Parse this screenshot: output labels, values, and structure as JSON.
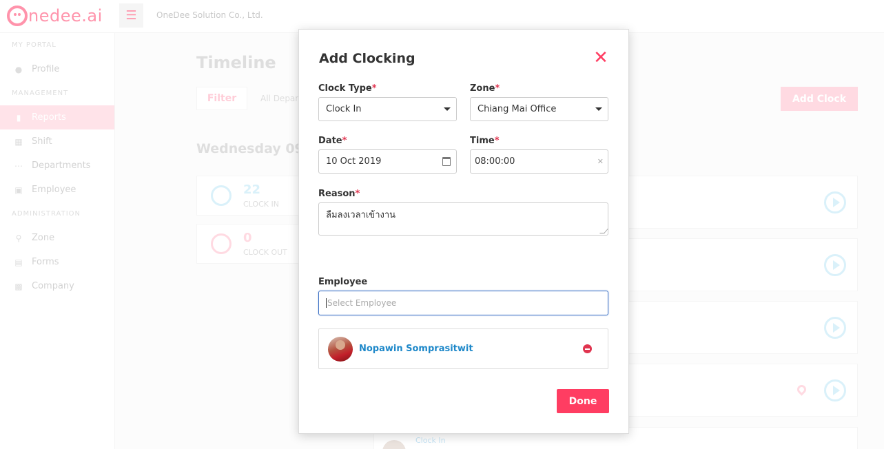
{
  "header": {
    "logo_text": "nedee.ai",
    "company": "OneDee Solution Co., Ltd."
  },
  "sidebar": {
    "sections": [
      {
        "title": "MY PORTAL",
        "items": [
          {
            "label": "Profile",
            "icon": "user-circle-icon"
          }
        ]
      },
      {
        "title": "MANAGEMENT",
        "items": [
          {
            "label": "Reports",
            "icon": "document-icon",
            "active": true
          },
          {
            "label": "Shift",
            "icon": "shift-icon"
          },
          {
            "label": "Departments",
            "icon": "users-icon"
          },
          {
            "label": "Employee",
            "icon": "id-card-icon"
          }
        ]
      },
      {
        "title": "ADMINISTRATION",
        "items": [
          {
            "label": "Zone",
            "icon": "pin-icon"
          },
          {
            "label": "Forms",
            "icon": "clipboard-icon"
          },
          {
            "label": "Company",
            "icon": "building-icon"
          }
        ]
      }
    ]
  },
  "main": {
    "title": "Timeline",
    "filter_label": "Filter",
    "department_filter": "All Depar",
    "add_clock_label": "Add Clock",
    "date_heading": "Wednesday 09",
    "stats": [
      {
        "value": "22",
        "label": "CLOCK IN",
        "color": "#c6eaf7"
      },
      {
        "value": "0",
        "label": "CLOCK OUT",
        "color": "#ffc7d3"
      }
    ],
    "bottom_entry_label": "Clock In"
  },
  "modal": {
    "title": "Add Clocking",
    "clock_type": {
      "label": "Clock Type",
      "value": "Clock In"
    },
    "zone": {
      "label": "Zone",
      "value": "Chiang Mai Office"
    },
    "date": {
      "label": "Date",
      "value": "10 Oct 2019"
    },
    "time": {
      "label": "Time",
      "value": "08:00:00"
    },
    "reason": {
      "label": "Reason",
      "value": "ลืมลงเวลาเข้างาน"
    },
    "employee": {
      "label": "Employee",
      "placeholder": "Select Employee",
      "selected": [
        {
          "name": "Nopawin Somprasitwit"
        }
      ]
    },
    "done_label": "Done",
    "required_mark": "*"
  },
  "colors": {
    "accent": "#ff3d62",
    "brand": "#ff5a7e",
    "link": "#1e88c9",
    "focus": "#3b6fc4"
  }
}
